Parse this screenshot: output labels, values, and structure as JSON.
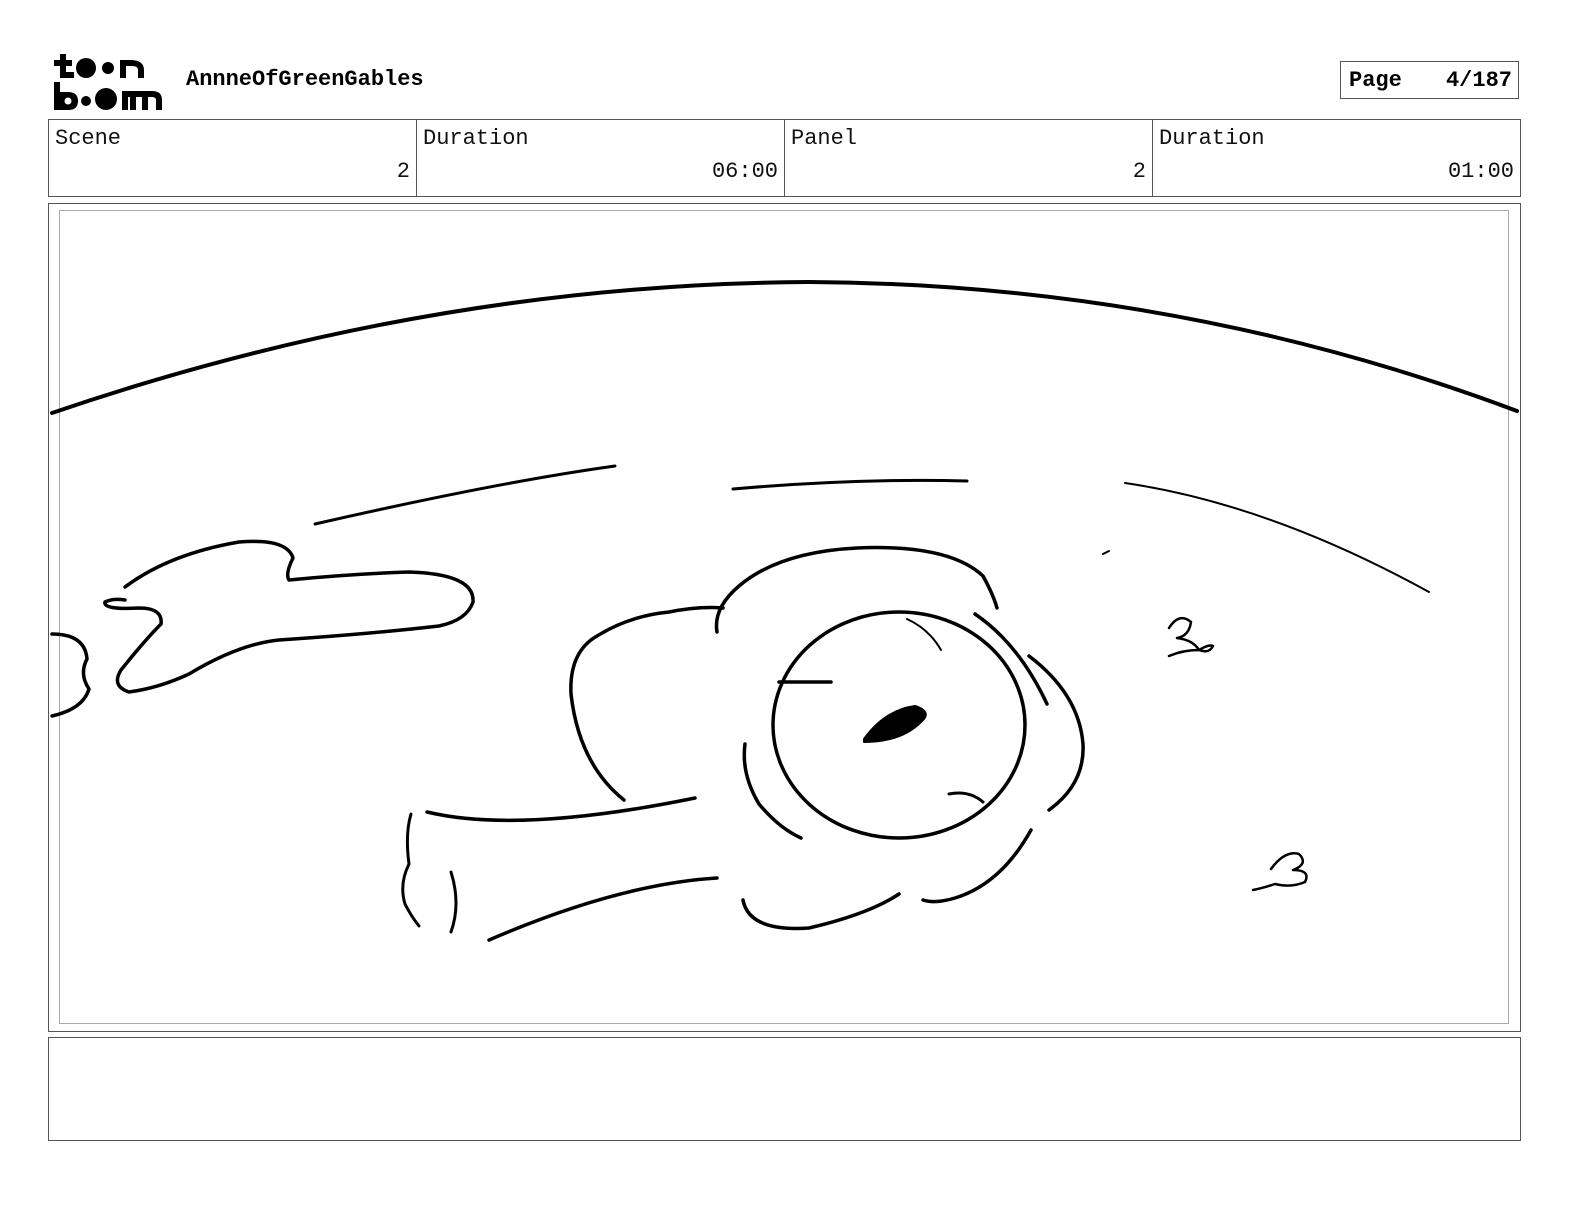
{
  "header": {
    "logo_text_top": "toon",
    "logo_text_bottom": "boom",
    "project_title": "AnnneOfGreenGables",
    "page_label": "Page",
    "page_value": "4/187"
  },
  "info": {
    "scene_label": "Scene",
    "scene_value": "2",
    "scene_duration_label": "Duration",
    "scene_duration_value": "06:00",
    "panel_label": "Panel",
    "panel_value": "2",
    "panel_duration_label": "Duration",
    "panel_duration_value": "01:00"
  },
  "notes": {
    "text": ""
  }
}
